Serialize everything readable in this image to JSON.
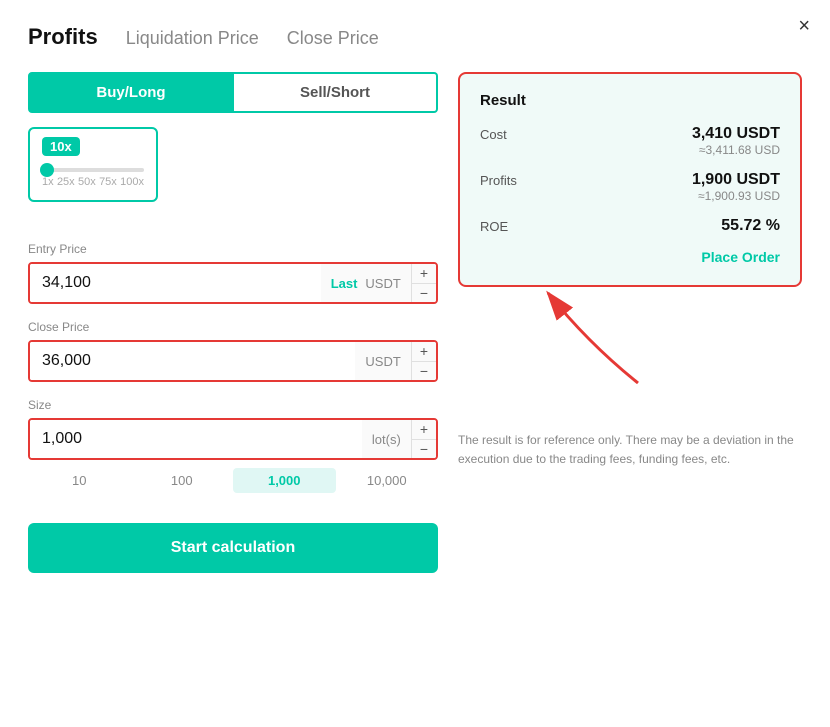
{
  "modal": {
    "close_icon": "×"
  },
  "header": {
    "tabs": [
      {
        "label": "Profits",
        "active": true
      },
      {
        "label": "Liquidation Price",
        "active": false
      },
      {
        "label": "Close Price",
        "active": false
      }
    ]
  },
  "left": {
    "buy_long_label": "Buy/Long",
    "sell_short_label": "Sell/Short",
    "leverage": {
      "badge": "10x",
      "labels": [
        "1x",
        "25x",
        "50x",
        "75x",
        "100x"
      ]
    },
    "entry_price": {
      "label": "Entry Price",
      "value": "34,100",
      "last_badge": "Last",
      "unit": "USDT"
    },
    "close_price": {
      "label": "Close Price",
      "value": "36,000",
      "unit": "USDT"
    },
    "size": {
      "label": "Size",
      "value": "1,000",
      "unit": "lot(s)",
      "picks": [
        "10",
        "100",
        "1,000",
        "10,000"
      ]
    },
    "calc_button": "Start calculation"
  },
  "right": {
    "result_title": "Result",
    "cost_label": "Cost",
    "cost_main": "3,410 USDT",
    "cost_sub": "≈3,411.68 USD",
    "profits_label": "Profits",
    "profits_main": "1,900 USDT",
    "profits_sub": "≈1,900.93 USD",
    "roe_label": "ROE",
    "roe_value": "55.72 %",
    "place_order": "Place Order",
    "disclaimer": "The result is for reference only. There may be a deviation in the execution due to the trading fees, funding fees, etc."
  }
}
